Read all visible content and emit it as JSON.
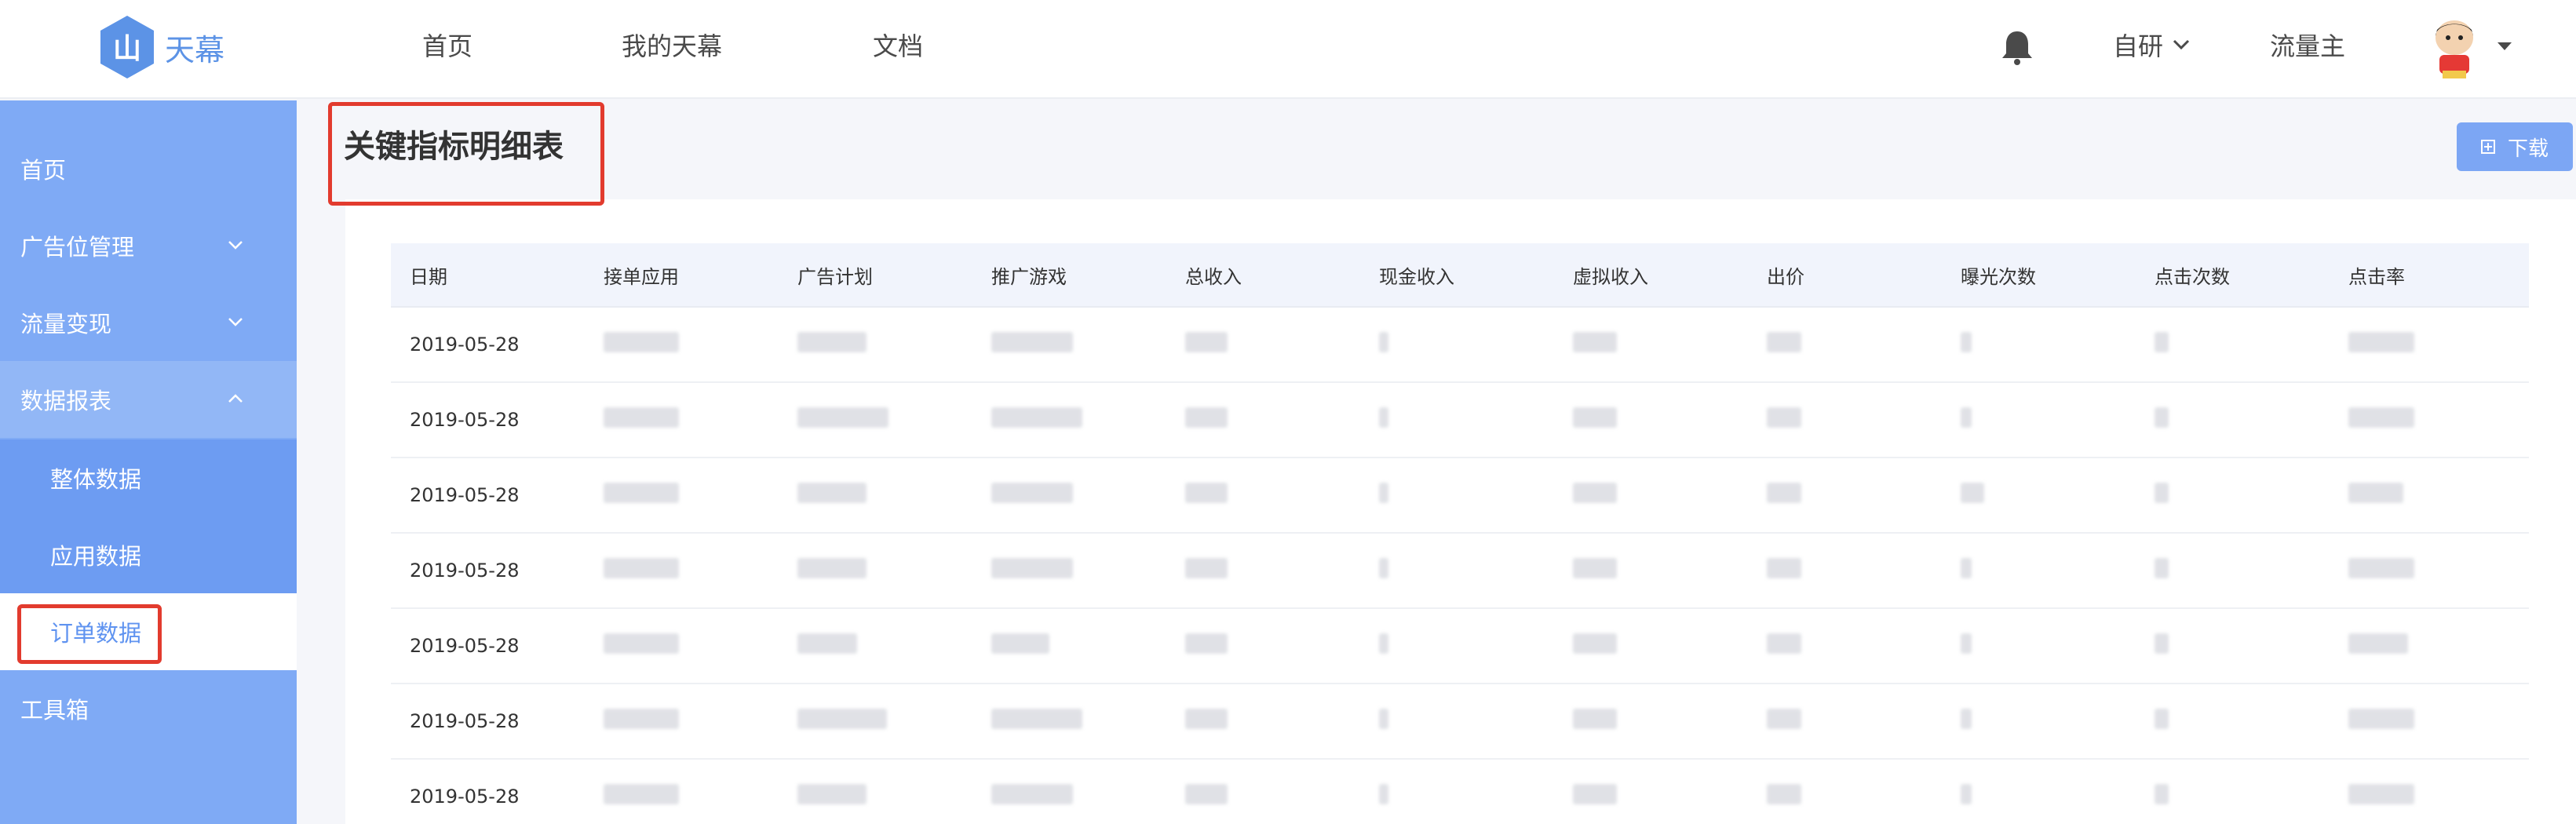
{
  "header": {
    "logo_text": "天幕",
    "nav": [
      "首页",
      "我的天幕",
      "文档"
    ],
    "org_dropdown": "自研",
    "role": "流量主"
  },
  "sidebar": {
    "items": [
      {
        "label": "首页"
      },
      {
        "label": "广告位管理"
      },
      {
        "label": "流量变现"
      },
      {
        "label": "数据报表"
      },
      {
        "label": "整体数据"
      },
      {
        "label": "应用数据"
      },
      {
        "label": "订单数据"
      },
      {
        "label": "工具箱"
      }
    ]
  },
  "page": {
    "title": "关键指标明细表",
    "download_label": "下载"
  },
  "table": {
    "headers": [
      "日期",
      "接单应用",
      "广告计划",
      "推广游戏",
      "总收入",
      "现金收入",
      "虚拟收入",
      "出价",
      "曝光次数",
      "点击次数",
      "点击率"
    ],
    "rows": [
      {
        "date": "2019-05-28"
      },
      {
        "date": "2019-05-28"
      },
      {
        "date": "2019-05-28"
      },
      {
        "date": "2019-05-28"
      },
      {
        "date": "2019-05-28"
      },
      {
        "date": "2019-05-28"
      },
      {
        "date": "2019-05-28"
      }
    ]
  },
  "colors": {
    "sidebar": "#7faaf5",
    "accent": "#5f93f0",
    "annotation": "#e23b2e"
  }
}
